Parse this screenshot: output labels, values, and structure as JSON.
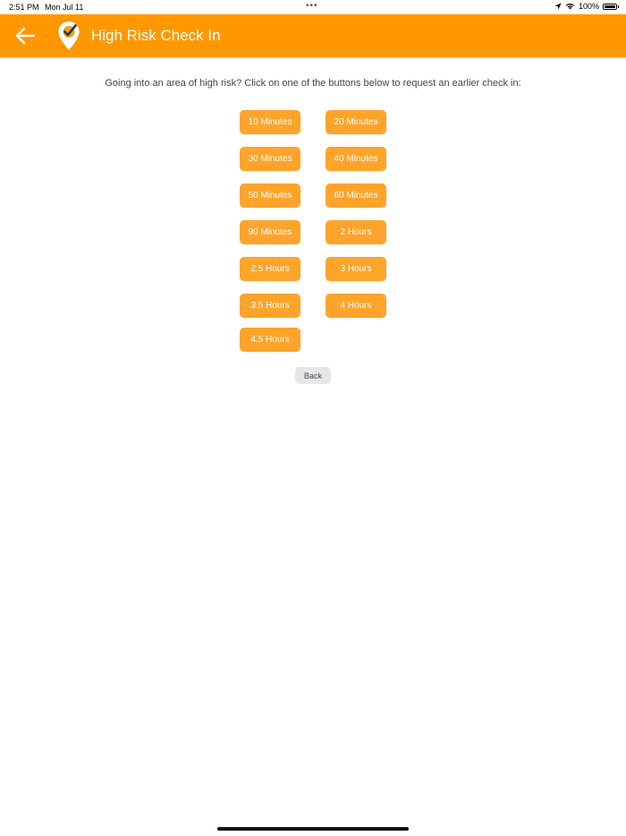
{
  "status_bar": {
    "time": "2:51 PM",
    "date": "Mon Jul 11",
    "battery": "100%"
  },
  "header": {
    "title": "High Risk Check In",
    "background_color": "#ff9800"
  },
  "instruction": "Going into an area of high risk? Click on one of the buttons below to request an earlier check in:",
  "options": [
    "10 Minutes",
    "20 Minutes",
    "30 Minutes",
    "40 Minutes",
    "50 Minutes",
    "60 Minutes",
    "90 Minutes",
    "2 Hours",
    "2.5 Hours",
    "3 Hours",
    "3.5 Hours",
    "4 Hours",
    "4.5 Hours"
  ],
  "back_button": "Back",
  "icons": {
    "back": "arrow-left-icon",
    "logo": "location-pin-check-icon",
    "location": "location-arrow-icon",
    "wifi": "wifi-icon",
    "battery": "battery-icon"
  },
  "colors": {
    "accent": "#ff9800",
    "button": "#ffa42b",
    "secondary_button": "#e6e6ea"
  }
}
